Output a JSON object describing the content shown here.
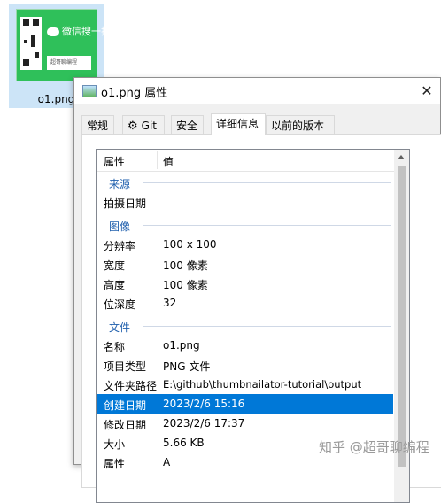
{
  "desktop": {
    "thumbnail_label": "o1.png",
    "thumbnail_text": "微信搜一搜",
    "thumbnail_search": "超哥聊编程"
  },
  "window": {
    "title": "o1.png 属性",
    "close_icon": "close-icon"
  },
  "tabs": [
    {
      "label": "常规"
    },
    {
      "label": "Git",
      "icon": "gear-icon"
    },
    {
      "label": "安全"
    },
    {
      "label": "详细信息"
    },
    {
      "label": "以前的版本"
    }
  ],
  "list": {
    "header": {
      "col1": "属性",
      "col2": "值"
    },
    "groups": {
      "source": "来源",
      "image": "图像",
      "file": "文件"
    },
    "rows": {
      "date_taken": {
        "key": "拍摄日期",
        "value": ""
      },
      "resolution": {
        "key": "分辨率",
        "value": "100 x 100"
      },
      "width": {
        "key": "宽度",
        "value": "100 像素"
      },
      "height": {
        "key": "高度",
        "value": "100 像素"
      },
      "bit_depth": {
        "key": "位深度",
        "value": "32"
      },
      "name": {
        "key": "名称",
        "value": "o1.png"
      },
      "item_type": {
        "key": "项目类型",
        "value": "PNG 文件"
      },
      "folder_path": {
        "key": "文件夹路径",
        "value": "E:\\github\\thumbnailator-tutorial\\output"
      },
      "created": {
        "key": "创建日期",
        "value": "2023/2/6 15:16"
      },
      "modified": {
        "key": "修改日期",
        "value": "2023/2/6 17:37"
      },
      "size": {
        "key": "大小",
        "value": "5.66 KB"
      },
      "attributes": {
        "key": "属性",
        "value": "A"
      }
    }
  },
  "watermark": "知乎 @超哥聊编程",
  "colors": {
    "selection": "#0078d7",
    "group_text": "#1f5fad",
    "thumb_green": "#2fc05a"
  }
}
